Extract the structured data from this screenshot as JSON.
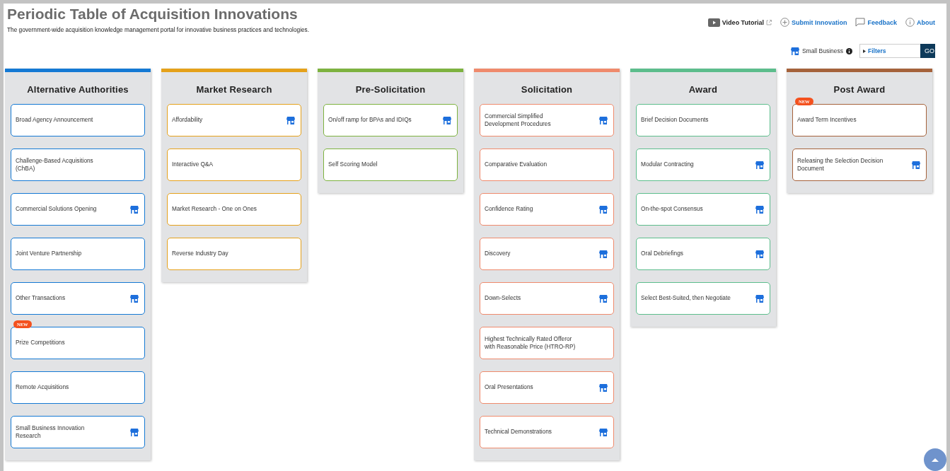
{
  "header": {
    "title": "Periodic Table of Acquisition Innovations",
    "subtitle": "The government-wide acquisition knowledge management portal for innovative business practices and technologies.",
    "links": [
      {
        "kind": "video",
        "label": "Video Tutorial"
      },
      {
        "kind": "submit",
        "label": "Submit Innovation"
      },
      {
        "kind": "feedback",
        "label": "Feedback"
      },
      {
        "kind": "about",
        "label": "About"
      }
    ],
    "small_business_label": "Small Business",
    "filters": "Filters",
    "go": "GO"
  },
  "columns": [
    {
      "title": "Alternative Authorities",
      "color": "#1479d4",
      "items": [
        {
          "label": "Broad Agency Announcement",
          "small_business": false
        },
        {
          "label": "Challenge-Based Acquisitions\n(ChBA)",
          "small_business": false
        },
        {
          "label": "Commercial Solutions Opening",
          "small_business": true
        },
        {
          "label": "Joint Venture Partnership",
          "small_business": false
        },
        {
          "label": "Other Transactions",
          "small_business": true
        },
        {
          "label": "Prize Competitions",
          "small_business": false,
          "badge": "NEW"
        },
        {
          "label": "Remote Acquisitions",
          "small_business": false
        },
        {
          "label": "Small Business Innovation\nResearch",
          "small_business": true
        }
      ]
    },
    {
      "title": "Market Research",
      "color": "#e5a11a",
      "items": [
        {
          "label": "Affordability",
          "small_business": true
        },
        {
          "label": "Interactive Q&A",
          "small_business": false
        },
        {
          "label": "Market Research - One on Ones",
          "small_business": false
        },
        {
          "label": "Reverse Industry Day",
          "small_business": false
        }
      ]
    },
    {
      "title": "Pre-Solicitation",
      "color": "#7db23f",
      "items": [
        {
          "label": "On/off ramp for BPAs and IDIQs",
          "small_business": true
        },
        {
          "label": "Self Scoring Model",
          "small_business": false
        }
      ]
    },
    {
      "title": "Solicitation",
      "color": "#ef8a6c",
      "items": [
        {
          "label": "Commercial Simplified\nDevelopment Procedures",
          "small_business": true
        },
        {
          "label": "Comparative Evaluation",
          "small_business": false
        },
        {
          "label": "Confidence Rating",
          "small_business": true
        },
        {
          "label": "Discovery",
          "small_business": true
        },
        {
          "label": "Down-Selects",
          "small_business": true
        },
        {
          "label": "Highest Technically Rated Offeror\nwith Reasonable Price (HTRO-RP)",
          "small_business": false
        },
        {
          "label": "Oral Presentations",
          "small_business": true
        },
        {
          "label": "Technical Demonstrations",
          "small_business": true
        }
      ]
    },
    {
      "title": "Award",
      "color": "#5cbd8c",
      "items": [
        {
          "label": "Brief Decision Documents",
          "small_business": false
        },
        {
          "label": "Modular Contracting",
          "small_business": true
        },
        {
          "label": "On-the-spot Consensus",
          "small_business": true
        },
        {
          "label": "Oral Debriefings",
          "small_business": true
        },
        {
          "label": "Select Best-Suited, then Negotiate",
          "small_business": true
        }
      ]
    },
    {
      "title": "Post Award",
      "color": "#a5623b",
      "items": [
        {
          "label": "Award Term Incentives",
          "small_business": false,
          "badge": "NEW"
        },
        {
          "label": "Releasing the Selection Decision\nDocument",
          "small_business": true
        }
      ]
    }
  ]
}
